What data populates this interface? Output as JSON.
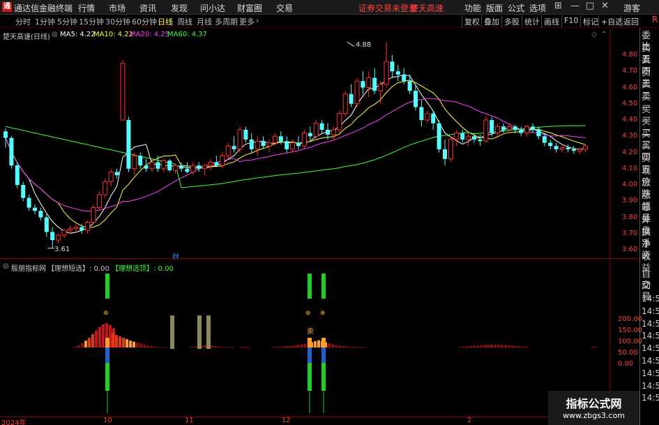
{
  "menu": {
    "logo": "通",
    "app_title": "通达信金融终端",
    "items": [
      "行情",
      "市场",
      "资讯",
      "发现",
      "问小达",
      "财富圈",
      "交易"
    ],
    "warning": "证券交易未登录",
    "stock_name_top": "楚天高速",
    "right_items": [
      "功能",
      "版面",
      "公式",
      "选项"
    ],
    "window": [
      "⊞",
      "—",
      "□",
      "✕"
    ],
    "user": "游客"
  },
  "toolbar": {
    "periods": [
      "分时",
      "1分钟",
      "5分钟",
      "15分钟",
      "30分钟",
      "60分钟",
      "日线",
      "周线",
      "月线",
      "多周期",
      "更多"
    ],
    "active": "日线",
    "buttons": [
      "复权",
      "叠加",
      "多股",
      "统计",
      "画线",
      "F10",
      "标记",
      "+自选",
      "返回"
    ]
  },
  "main_chart": {
    "title": "楚天高速(日线)",
    "ma_legend": [
      {
        "label": "MA5: 4.22",
        "color": "#ffffff"
      },
      {
        "label": "MA10: 4.22",
        "color": "#ffff40"
      },
      {
        "label": "MA20: 4.25",
        "color": "#ff40ff"
      },
      {
        "label": "MA60: 4.37",
        "color": "#40ff40"
      }
    ],
    "y_labels": [
      "4.80",
      "4.70",
      "4.60",
      "4.50",
      "4.40",
      "4.30",
      "4.20",
      "4.10",
      "4.00",
      "3.90",
      "3.80",
      "3.70",
      "3.60"
    ],
    "high_label": "4.88",
    "low_label": "3.61",
    "cai_marker": "财"
  },
  "sub_chart": {
    "title": "殷朋指标网",
    "legend1": "【理想短选】: 0.00",
    "legend2": "【理想选顶】: 0.00",
    "y_labels": [
      "200.00",
      "150.00",
      "100.00",
      "50.00",
      "0.00"
    ],
    "marker_label": "卖"
  },
  "x_labels": [
    "2024年",
    "10",
    "11",
    "12",
    "2"
  ],
  "sidebar": {
    "labels": [
      "委比",
      "卖五",
      "卖四",
      "卖三",
      "卖二",
      "卖一",
      "买一",
      "买二",
      "买三",
      "买四",
      "买五",
      "现价",
      "涨跌",
      "涨幅",
      "总量",
      "外盘",
      "换手",
      "净资",
      "收益"
    ],
    "tab1": "自动",
    "tab2": "交易",
    "times": [
      "14:56",
      "14:56",
      "14:56",
      "14:56",
      "14:56",
      "14:56",
      "14:56",
      "14:56",
      "14:5"
    ],
    "r_label": "R"
  },
  "watermark": {
    "title": "指标公式网",
    "url": "www.zbgs3.com"
  },
  "colors": {
    "up": "#ff3232",
    "down": "#54ffff",
    "ma5": "#ffffff",
    "ma10": "#ffff40",
    "ma20": "#ff40ff",
    "ma60": "#40ff40"
  },
  "chart_data": {
    "type": "candlestick",
    "ylim": [
      3.58,
      4.88
    ],
    "candles": [
      [
        4.33,
        4.35,
        4.23,
        4.29
      ],
      [
        4.29,
        4.3,
        4.1,
        4.12
      ],
      [
        4.12,
        4.14,
        3.98,
        4.0
      ],
      [
        4.0,
        4.02,
        3.9,
        3.92
      ],
      [
        3.92,
        3.94,
        3.84,
        3.86
      ],
      [
        3.86,
        3.88,
        3.82,
        3.84
      ],
      [
        3.84,
        3.86,
        3.78,
        3.8
      ],
      [
        3.8,
        3.82,
        3.68,
        3.71
      ],
      [
        3.71,
        3.74,
        3.61,
        3.66
      ],
      [
        3.66,
        3.7,
        3.64,
        3.69
      ],
      [
        3.69,
        3.73,
        3.67,
        3.72
      ],
      [
        3.72,
        3.75,
        3.7,
        3.73
      ],
      [
        3.73,
        3.76,
        3.71,
        3.74
      ],
      [
        3.74,
        3.76,
        3.7,
        3.72
      ],
      [
        3.72,
        3.78,
        3.7,
        3.77
      ],
      [
        3.77,
        3.88,
        3.76,
        3.86
      ],
      [
        3.86,
        3.96,
        3.85,
        3.94
      ],
      [
        3.94,
        4.04,
        3.92,
        4.02
      ],
      [
        4.02,
        4.1,
        3.99,
        4.08
      ],
      [
        4.08,
        4.1,
        4.04,
        4.06
      ],
      [
        4.4,
        4.77,
        4.4,
        4.75
      ],
      [
        4.4,
        4.42,
        4.08,
        4.1
      ],
      [
        4.1,
        4.2,
        4.06,
        4.18
      ],
      [
        4.18,
        4.2,
        4.1,
        4.12
      ],
      [
        4.12,
        4.16,
        4.08,
        4.1
      ],
      [
        4.1,
        4.16,
        4.08,
        4.14
      ],
      [
        4.14,
        4.18,
        4.08,
        4.1
      ],
      [
        4.1,
        4.16,
        4.08,
        4.15
      ],
      [
        4.15,
        4.16,
        4.08,
        4.09
      ],
      [
        4.09,
        4.13,
        4.07,
        4.12
      ],
      [
        4.12,
        4.14,
        4.08,
        4.1
      ],
      [
        4.1,
        4.14,
        4.07,
        4.08
      ],
      [
        4.08,
        4.14,
        4.06,
        4.12
      ],
      [
        4.12,
        4.14,
        4.08,
        4.1
      ],
      [
        4.1,
        4.13,
        4.06,
        4.12
      ],
      [
        4.12,
        4.16,
        4.09,
        4.14
      ],
      [
        4.14,
        4.18,
        4.11,
        4.12
      ],
      [
        4.12,
        4.2,
        4.1,
        4.18
      ],
      [
        4.18,
        4.26,
        4.16,
        4.24
      ],
      [
        4.24,
        4.3,
        4.2,
        4.22
      ],
      [
        4.22,
        4.36,
        4.2,
        4.34
      ],
      [
        4.34,
        4.36,
        4.26,
        4.28
      ],
      [
        4.28,
        4.32,
        4.2,
        4.22
      ],
      [
        4.22,
        4.3,
        4.18,
        4.27
      ],
      [
        4.27,
        4.3,
        4.22,
        4.24
      ],
      [
        4.24,
        4.28,
        4.2,
        4.26
      ],
      [
        4.26,
        4.32,
        4.24,
        4.3
      ],
      [
        4.3,
        4.33,
        4.25,
        4.27
      ],
      [
        4.27,
        4.3,
        4.2,
        4.22
      ],
      [
        4.22,
        4.28,
        4.2,
        4.26
      ],
      [
        4.26,
        4.3,
        4.22,
        4.24
      ],
      [
        4.24,
        4.34,
        4.22,
        4.32
      ],
      [
        4.32,
        4.36,
        4.27,
        4.3
      ],
      [
        4.3,
        4.4,
        4.28,
        4.38
      ],
      [
        4.38,
        4.4,
        4.32,
        4.34
      ],
      [
        4.34,
        4.38,
        4.28,
        4.31
      ],
      [
        4.31,
        4.36,
        4.28,
        4.34
      ],
      [
        4.34,
        4.46,
        4.32,
        4.44
      ],
      [
        4.44,
        4.58,
        4.42,
        4.56
      ],
      [
        4.56,
        4.62,
        4.48,
        4.5
      ],
      [
        4.5,
        4.66,
        4.48,
        4.64
      ],
      [
        4.64,
        4.7,
        4.56,
        4.6
      ],
      [
        4.6,
        4.7,
        4.54,
        4.66
      ],
      [
        4.66,
        4.72,
        4.56,
        4.58
      ],
      [
        4.58,
        4.64,
        4.5,
        4.62
      ],
      [
        4.62,
        4.88,
        4.6,
        4.76
      ],
      [
        4.76,
        4.8,
        4.66,
        4.7
      ],
      [
        4.7,
        4.74,
        4.64,
        4.68
      ],
      [
        4.68,
        4.72,
        4.62,
        4.64
      ],
      [
        4.64,
        4.68,
        4.56,
        4.58
      ],
      [
        4.58,
        4.62,
        4.46,
        4.48
      ],
      [
        4.48,
        4.52,
        4.36,
        4.4
      ],
      [
        4.4,
        4.46,
        4.38,
        4.44
      ],
      [
        4.44,
        4.46,
        4.34,
        4.38
      ],
      [
        4.38,
        4.4,
        4.2,
        4.22
      ],
      [
        4.22,
        4.28,
        4.12,
        4.16
      ],
      [
        4.16,
        4.3,
        4.14,
        4.28
      ],
      [
        4.28,
        4.34,
        4.24,
        4.32
      ],
      [
        4.32,
        4.34,
        4.26,
        4.28
      ],
      [
        4.28,
        4.32,
        4.24,
        4.3
      ],
      [
        4.3,
        4.32,
        4.26,
        4.28
      ],
      [
        4.28,
        4.31,
        4.24,
        4.27
      ],
      [
        4.27,
        4.42,
        4.26,
        4.4
      ],
      [
        4.4,
        4.42,
        4.3,
        4.32
      ],
      [
        4.32,
        4.38,
        4.3,
        4.36
      ],
      [
        4.36,
        4.38,
        4.32,
        4.34
      ],
      [
        4.34,
        4.38,
        4.32,
        4.36
      ],
      [
        4.36,
        4.37,
        4.32,
        4.34
      ],
      [
        4.34,
        4.36,
        4.3,
        4.32
      ],
      [
        4.32,
        4.37,
        4.3,
        4.36
      ],
      [
        4.36,
        4.38,
        4.32,
        4.34
      ],
      [
        4.34,
        4.36,
        4.28,
        4.3
      ],
      [
        4.3,
        4.32,
        4.24,
        4.26
      ],
      [
        4.26,
        4.28,
        4.22,
        4.24
      ],
      [
        4.24,
        4.26,
        4.2,
        4.22
      ],
      [
        4.22,
        4.24,
        4.2,
        4.23
      ],
      [
        4.23,
        4.25,
        4.2,
        4.22
      ],
      [
        4.22,
        4.24,
        4.19,
        4.21
      ],
      [
        4.21,
        4.23,
        4.19,
        4.22
      ],
      [
        4.22,
        4.25,
        4.2,
        4.24
      ]
    ],
    "signal_bars_green_x": [
      154,
      444,
      464
    ],
    "signal_bars_khaki_x": [
      247,
      286,
      299
    ]
  }
}
